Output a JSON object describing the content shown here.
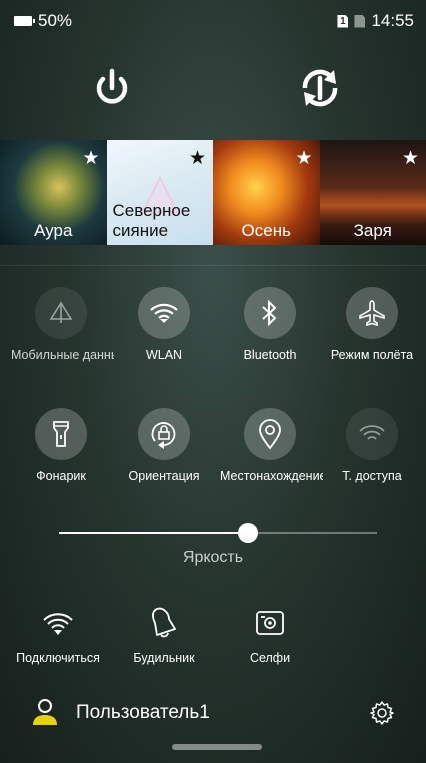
{
  "status_bar": {
    "battery_level": "50%",
    "sim_label": "1",
    "time": "14:55"
  },
  "themes": [
    {
      "label": "Аура",
      "starred": true
    },
    {
      "label": "Северное сияние",
      "starred": true
    },
    {
      "label": "Осень",
      "starred": true
    },
    {
      "label": "Заря",
      "starred": true
    }
  ],
  "toggles_row1": [
    {
      "label": "Мобильные данные",
      "icon": "mobile-data-icon",
      "active": false
    },
    {
      "label": "WLAN",
      "icon": "wifi-icon",
      "active": true
    },
    {
      "label": "Bluetooth",
      "icon": "bluetooth-icon",
      "active": true
    },
    {
      "label": "Режим полёта",
      "icon": "airplane-icon",
      "active": true
    }
  ],
  "toggles_row2": [
    {
      "label": "Фонарик",
      "icon": "flashlight-icon",
      "active": true
    },
    {
      "label": "Ориентация",
      "icon": "rotation-lock-icon",
      "active": true
    },
    {
      "label": "Местонахождение",
      "icon": "location-icon",
      "active": true
    },
    {
      "label": "Т. доступа",
      "icon": "hotspot-icon",
      "active": false
    }
  ],
  "brightness": {
    "label": "Яркость",
    "level": 0.6
  },
  "shortcuts": [
    {
      "label": "Подключиться",
      "icon": "wifi-icon"
    },
    {
      "label": "Будильник",
      "icon": "alarm-bell-icon"
    },
    {
      "label": "Селфи",
      "icon": "selfie-camera-icon"
    }
  ],
  "user": {
    "name": "Пользователь1"
  },
  "colors": {
    "accent_avatar": "#e6d200",
    "background": "#27352f"
  }
}
